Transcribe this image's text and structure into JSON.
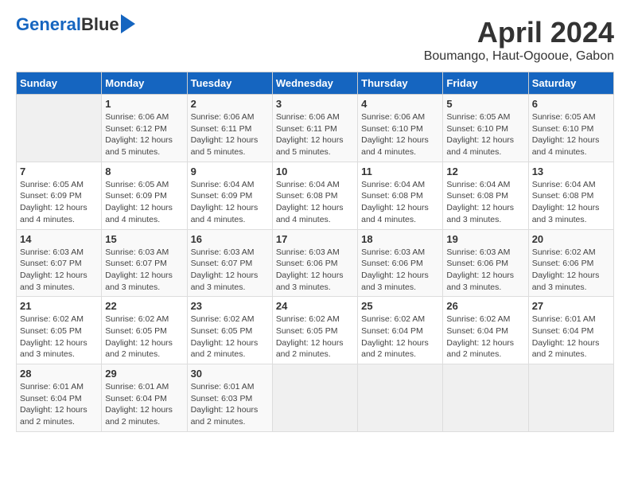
{
  "header": {
    "logo_line1": "General",
    "logo_line2": "Blue",
    "title": "April 2024",
    "subtitle": "Boumango, Haut-Ogooue, Gabon"
  },
  "days_of_week": [
    "Sunday",
    "Monday",
    "Tuesday",
    "Wednesday",
    "Thursday",
    "Friday",
    "Saturday"
  ],
  "weeks": [
    [
      {
        "day": "",
        "info": ""
      },
      {
        "day": "1",
        "info": "Sunrise: 6:06 AM\nSunset: 6:12 PM\nDaylight: 12 hours\nand 5 minutes."
      },
      {
        "day": "2",
        "info": "Sunrise: 6:06 AM\nSunset: 6:11 PM\nDaylight: 12 hours\nand 5 minutes."
      },
      {
        "day": "3",
        "info": "Sunrise: 6:06 AM\nSunset: 6:11 PM\nDaylight: 12 hours\nand 5 minutes."
      },
      {
        "day": "4",
        "info": "Sunrise: 6:06 AM\nSunset: 6:10 PM\nDaylight: 12 hours\nand 4 minutes."
      },
      {
        "day": "5",
        "info": "Sunrise: 6:05 AM\nSunset: 6:10 PM\nDaylight: 12 hours\nand 4 minutes."
      },
      {
        "day": "6",
        "info": "Sunrise: 6:05 AM\nSunset: 6:10 PM\nDaylight: 12 hours\nand 4 minutes."
      }
    ],
    [
      {
        "day": "7",
        "info": "Sunrise: 6:05 AM\nSunset: 6:09 PM\nDaylight: 12 hours\nand 4 minutes."
      },
      {
        "day": "8",
        "info": "Sunrise: 6:05 AM\nSunset: 6:09 PM\nDaylight: 12 hours\nand 4 minutes."
      },
      {
        "day": "9",
        "info": "Sunrise: 6:04 AM\nSunset: 6:09 PM\nDaylight: 12 hours\nand 4 minutes."
      },
      {
        "day": "10",
        "info": "Sunrise: 6:04 AM\nSunset: 6:08 PM\nDaylight: 12 hours\nand 4 minutes."
      },
      {
        "day": "11",
        "info": "Sunrise: 6:04 AM\nSunset: 6:08 PM\nDaylight: 12 hours\nand 4 minutes."
      },
      {
        "day": "12",
        "info": "Sunrise: 6:04 AM\nSunset: 6:08 PM\nDaylight: 12 hours\nand 3 minutes."
      },
      {
        "day": "13",
        "info": "Sunrise: 6:04 AM\nSunset: 6:08 PM\nDaylight: 12 hours\nand 3 minutes."
      }
    ],
    [
      {
        "day": "14",
        "info": "Sunrise: 6:03 AM\nSunset: 6:07 PM\nDaylight: 12 hours\nand 3 minutes."
      },
      {
        "day": "15",
        "info": "Sunrise: 6:03 AM\nSunset: 6:07 PM\nDaylight: 12 hours\nand 3 minutes."
      },
      {
        "day": "16",
        "info": "Sunrise: 6:03 AM\nSunset: 6:07 PM\nDaylight: 12 hours\nand 3 minutes."
      },
      {
        "day": "17",
        "info": "Sunrise: 6:03 AM\nSunset: 6:06 PM\nDaylight: 12 hours\nand 3 minutes."
      },
      {
        "day": "18",
        "info": "Sunrise: 6:03 AM\nSunset: 6:06 PM\nDaylight: 12 hours\nand 3 minutes."
      },
      {
        "day": "19",
        "info": "Sunrise: 6:03 AM\nSunset: 6:06 PM\nDaylight: 12 hours\nand 3 minutes."
      },
      {
        "day": "20",
        "info": "Sunrise: 6:02 AM\nSunset: 6:06 PM\nDaylight: 12 hours\nand 3 minutes."
      }
    ],
    [
      {
        "day": "21",
        "info": "Sunrise: 6:02 AM\nSunset: 6:05 PM\nDaylight: 12 hours\nand 3 minutes."
      },
      {
        "day": "22",
        "info": "Sunrise: 6:02 AM\nSunset: 6:05 PM\nDaylight: 12 hours\nand 2 minutes."
      },
      {
        "day": "23",
        "info": "Sunrise: 6:02 AM\nSunset: 6:05 PM\nDaylight: 12 hours\nand 2 minutes."
      },
      {
        "day": "24",
        "info": "Sunrise: 6:02 AM\nSunset: 6:05 PM\nDaylight: 12 hours\nand 2 minutes."
      },
      {
        "day": "25",
        "info": "Sunrise: 6:02 AM\nSunset: 6:04 PM\nDaylight: 12 hours\nand 2 minutes."
      },
      {
        "day": "26",
        "info": "Sunrise: 6:02 AM\nSunset: 6:04 PM\nDaylight: 12 hours\nand 2 minutes."
      },
      {
        "day": "27",
        "info": "Sunrise: 6:01 AM\nSunset: 6:04 PM\nDaylight: 12 hours\nand 2 minutes."
      }
    ],
    [
      {
        "day": "28",
        "info": "Sunrise: 6:01 AM\nSunset: 6:04 PM\nDaylight: 12 hours\nand 2 minutes."
      },
      {
        "day": "29",
        "info": "Sunrise: 6:01 AM\nSunset: 6:04 PM\nDaylight: 12 hours\nand 2 minutes."
      },
      {
        "day": "30",
        "info": "Sunrise: 6:01 AM\nSunset: 6:03 PM\nDaylight: 12 hours\nand 2 minutes."
      },
      {
        "day": "",
        "info": ""
      },
      {
        "day": "",
        "info": ""
      },
      {
        "day": "",
        "info": ""
      },
      {
        "day": "",
        "info": ""
      }
    ]
  ]
}
